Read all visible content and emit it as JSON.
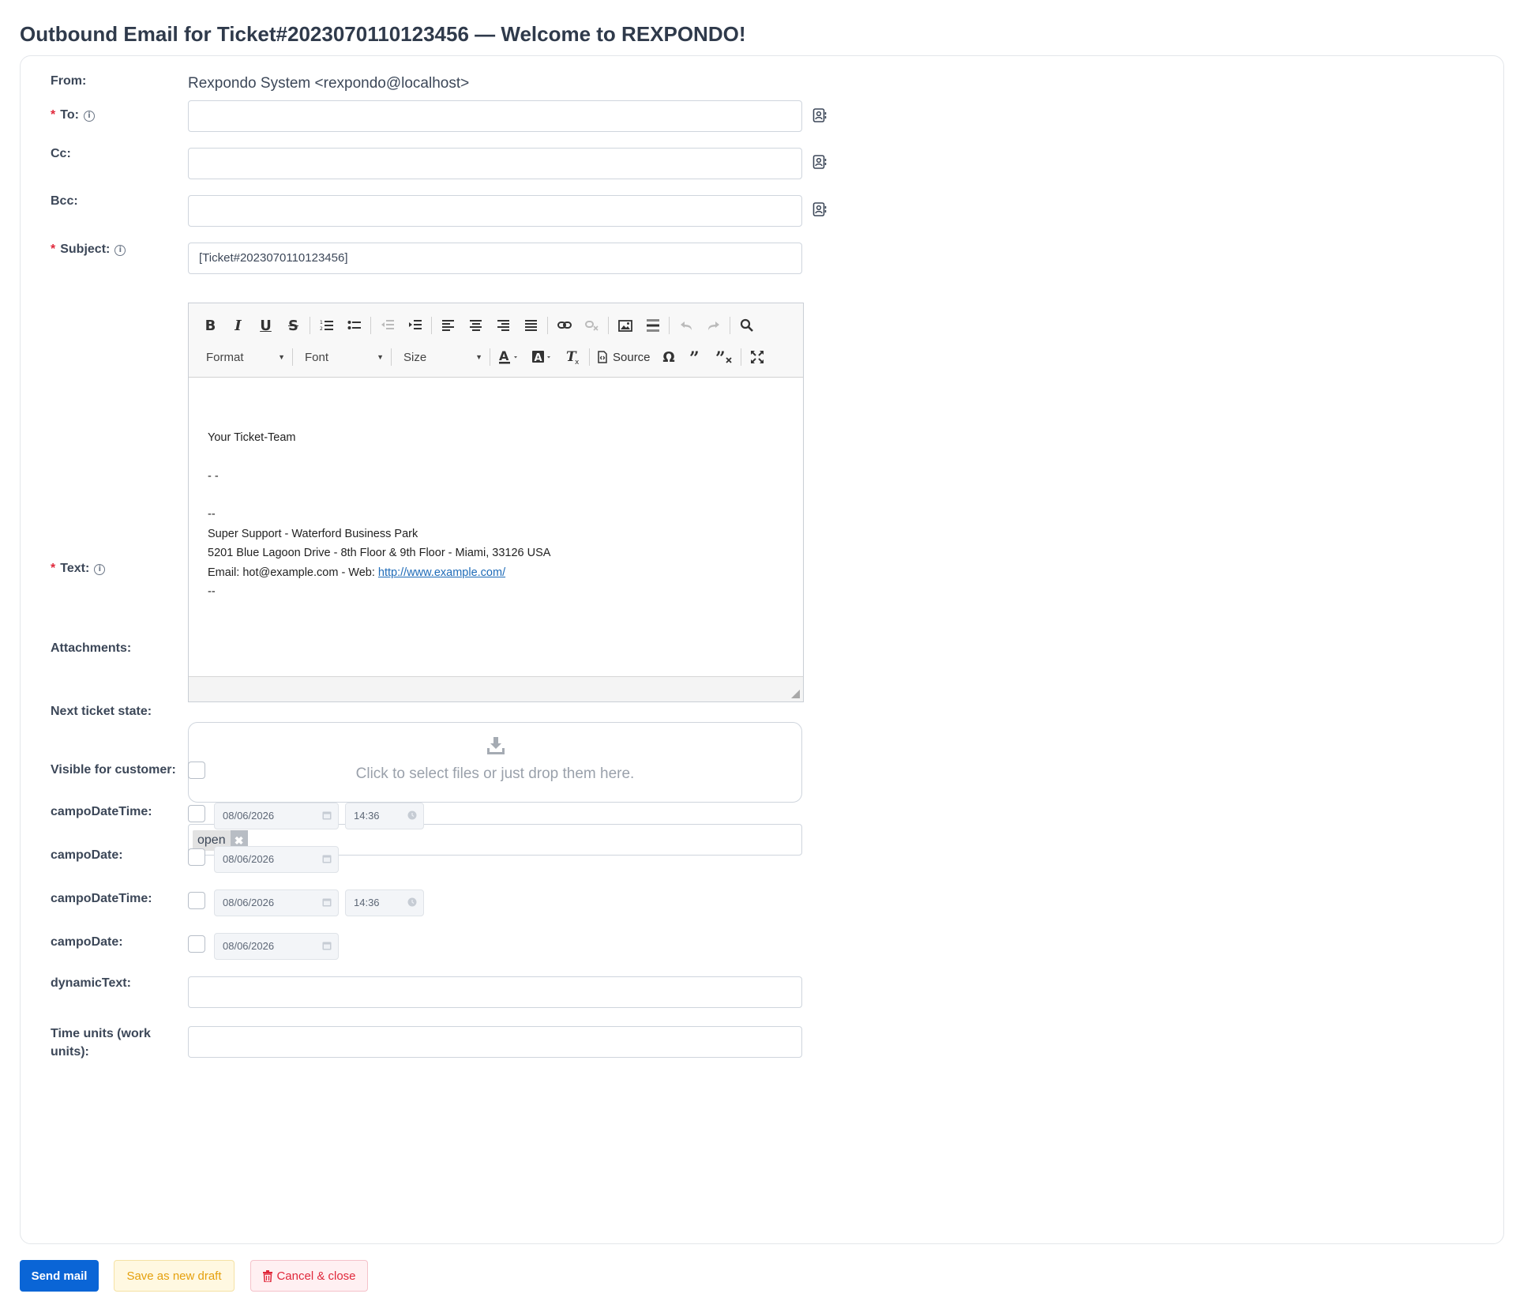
{
  "page": {
    "title": "Outbound Email for Ticket#2023070110123456 — Welcome to REXPONDO!"
  },
  "form": {
    "from_label": "From:",
    "from_value": "Rexpondo System <rexpondo@localhost>",
    "to_label": "To:",
    "to_value": "",
    "cc_label": "Cc:",
    "cc_value": "",
    "bcc_label": "Bcc:",
    "bcc_value": "",
    "subject_label": "Subject:",
    "subject_value": "[Ticket#2023070110123456]",
    "text_label": "Text:",
    "attachments_label": "Attachments:",
    "next_state_label": "Next ticket state:",
    "visible_label": "Visible for customer:",
    "dynamic_text_label": "dynamicText:",
    "dynamic_text_value": "",
    "time_units_label": "Time units (work units):",
    "time_units_value": ""
  },
  "editor": {
    "toolbar": {
      "format_label": "Format",
      "font_label": "Font",
      "size_label": "Size",
      "source_label": "Source"
    },
    "body_lines": [
      "",
      "Your Ticket-Team",
      "",
      "- -",
      "",
      "--",
      "Super Support - Waterford Business Park",
      "5201 Blue Lagoon Drive - 8th Floor & 9th Floor - Miami, 33126 USA"
    ],
    "email_prefix": "Email: hot@example.com - Web: ",
    "web_link": "http://www.example.com/",
    "closing_line": "--"
  },
  "attachments": {
    "dropzone_text": "Click to select files or just drop them here."
  },
  "next_state": {
    "selected": "open",
    "remove_glyph": "✖"
  },
  "dynamic_fields": [
    {
      "label": "campoDateTime:",
      "date": "08/06/2026",
      "time": "14:36"
    },
    {
      "label": "campoDate:",
      "date": "08/06/2026"
    },
    {
      "label": "campoDateTime:",
      "date": "08/06/2026",
      "time": "14:36"
    },
    {
      "label": "campoDate:",
      "date": "08/06/2026"
    }
  ],
  "actions": {
    "send": "Send mail",
    "draft": "Save as new draft",
    "cancel": "Cancel & close"
  },
  "colors": {
    "primary": "#0a65d6",
    "warning": "#e5a00d",
    "danger": "#e0283b",
    "required": "#e0283b"
  },
  "icons": {
    "address_book": "address-book-icon",
    "info": "info-icon",
    "upload": "download-tray-icon",
    "calendar": "calendar-icon",
    "clock": "clock-icon",
    "trash": "trash-icon"
  }
}
